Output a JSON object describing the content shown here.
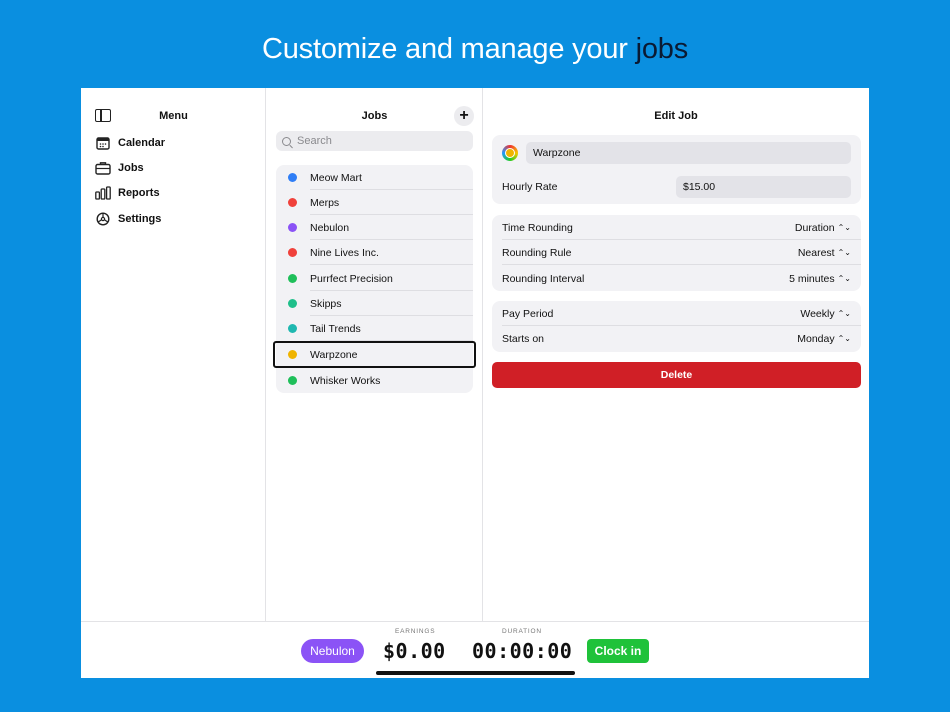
{
  "headline": {
    "prefix": "Customize and manage your",
    "accent": "jobs"
  },
  "menu": {
    "title": "Menu",
    "items": [
      {
        "label": "Calendar",
        "icon": "calendar-icon"
      },
      {
        "label": "Jobs",
        "icon": "briefcase-icon"
      },
      {
        "label": "Reports",
        "icon": "bar-chart-icon"
      },
      {
        "label": "Settings",
        "icon": "gear-icon"
      }
    ]
  },
  "jobs": {
    "title": "Jobs",
    "add_label": "+",
    "search_placeholder": "Search",
    "items": [
      {
        "name": "Meow Mart",
        "color": "#2f7ef6"
      },
      {
        "name": "Merps",
        "color": "#f0413b"
      },
      {
        "name": "Nebulon",
        "color": "#8b53f6"
      },
      {
        "name": "Nine Lives Inc.",
        "color": "#f0413b"
      },
      {
        "name": "Purrfect Precision",
        "color": "#1fbf5a"
      },
      {
        "name": "Skipps",
        "color": "#1fbf8a"
      },
      {
        "name": "Tail Trends",
        "color": "#1fb8b0"
      },
      {
        "name": "Warpzone",
        "color": "#f0b400",
        "selected": true
      },
      {
        "name": "Whisker Works",
        "color": "#1fbf5a"
      }
    ]
  },
  "edit": {
    "title": "Edit Job",
    "name_value": "Warpzone",
    "hourly_rate_label": "Hourly Rate",
    "hourly_rate_value": "$15.00",
    "time_rounding_label": "Time Rounding",
    "time_rounding_value": "Duration",
    "rounding_rule_label": "Rounding Rule",
    "rounding_rule_value": "Nearest",
    "rounding_interval_label": "Rounding Interval",
    "rounding_interval_value": "5 minutes",
    "pay_period_label": "Pay Period",
    "pay_period_value": "Weekly",
    "starts_on_label": "Starts on",
    "starts_on_value": "Monday",
    "delete_label": "Delete",
    "chevron": "⌃⌄"
  },
  "bottom": {
    "job_pill": "Nebulon",
    "job_pill_color": "#8b53f6",
    "earnings_label": "EARNINGS",
    "earnings_value": "$0.00",
    "duration_label": "DURATION",
    "duration_value": "00:00:00",
    "clock_in_label": "Clock in",
    "clock_in_color": "#1fc23a"
  }
}
